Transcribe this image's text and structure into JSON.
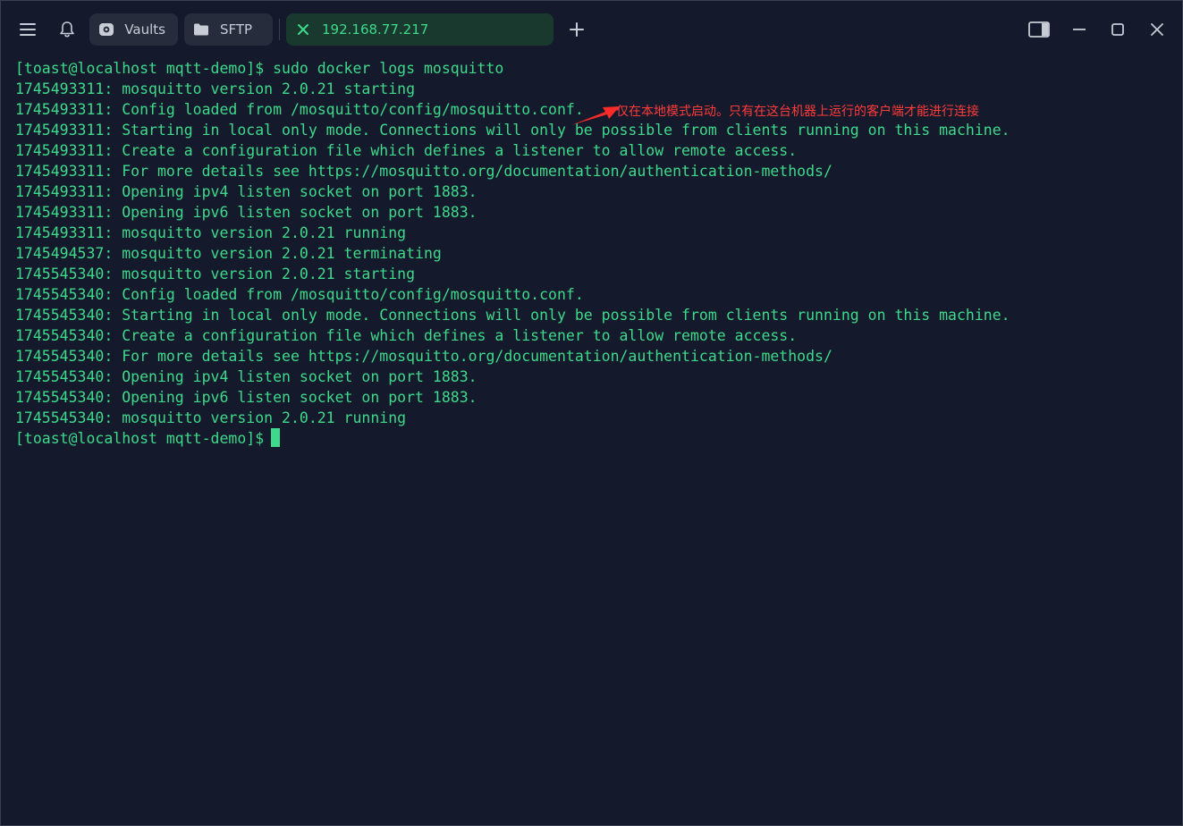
{
  "titlebar": {
    "tabs": [
      {
        "label": "Vaults",
        "icon": "vault-icon",
        "active": false
      },
      {
        "label": "SFTP",
        "icon": "folder-icon",
        "active": false
      },
      {
        "label": "192.168.77.217",
        "icon": "connected-x-icon",
        "active": true
      }
    ],
    "icons": [
      "menu-icon",
      "bell-icon",
      "add-tab-icon",
      "sidebar-toggle-icon",
      "minimize-icon",
      "maximize-icon",
      "close-icon"
    ],
    "accent_color": "#3ed98b"
  },
  "terminal": {
    "lines": [
      "[toast@localhost mqtt-demo]$ sudo docker logs mosquitto",
      "1745493311: mosquitto version 2.0.21 starting",
      "1745493311: Config loaded from /mosquitto/config/mosquitto.conf.",
      "1745493311: Starting in local only mode. Connections will only be possible from clients running on this machine.",
      "1745493311: Create a configuration file which defines a listener to allow remote access.",
      "1745493311: For more details see https://mosquitto.org/documentation/authentication-methods/",
      "1745493311: Opening ipv4 listen socket on port 1883.",
      "1745493311: Opening ipv6 listen socket on port 1883.",
      "1745493311: mosquitto version 2.0.21 running",
      "1745494537: mosquitto version 2.0.21 terminating",
      "1745545340: mosquitto version 2.0.21 starting",
      "1745545340: Config loaded from /mosquitto/config/mosquitto.conf.",
      "1745545340: Starting in local only mode. Connections will only be possible from clients running on this machine.",
      "1745545340: Create a configuration file which defines a listener to allow remote access.",
      "1745545340: For more details see https://mosquitto.org/documentation/authentication-methods/",
      "1745545340: Opening ipv4 listen socket on port 1883.",
      "1745545340: Opening ipv6 listen socket on port 1883.",
      "1745545340: mosquitto version 2.0.21 running"
    ],
    "prompt": "[toast@localhost mqtt-demo]$",
    "text_color": "#3ed98b",
    "background": "#141a2b"
  },
  "annotation": {
    "text": "仅在本地模式启动。只有在这台机器上运行的客户端才能进行连接",
    "color": "#ff3b3b"
  }
}
